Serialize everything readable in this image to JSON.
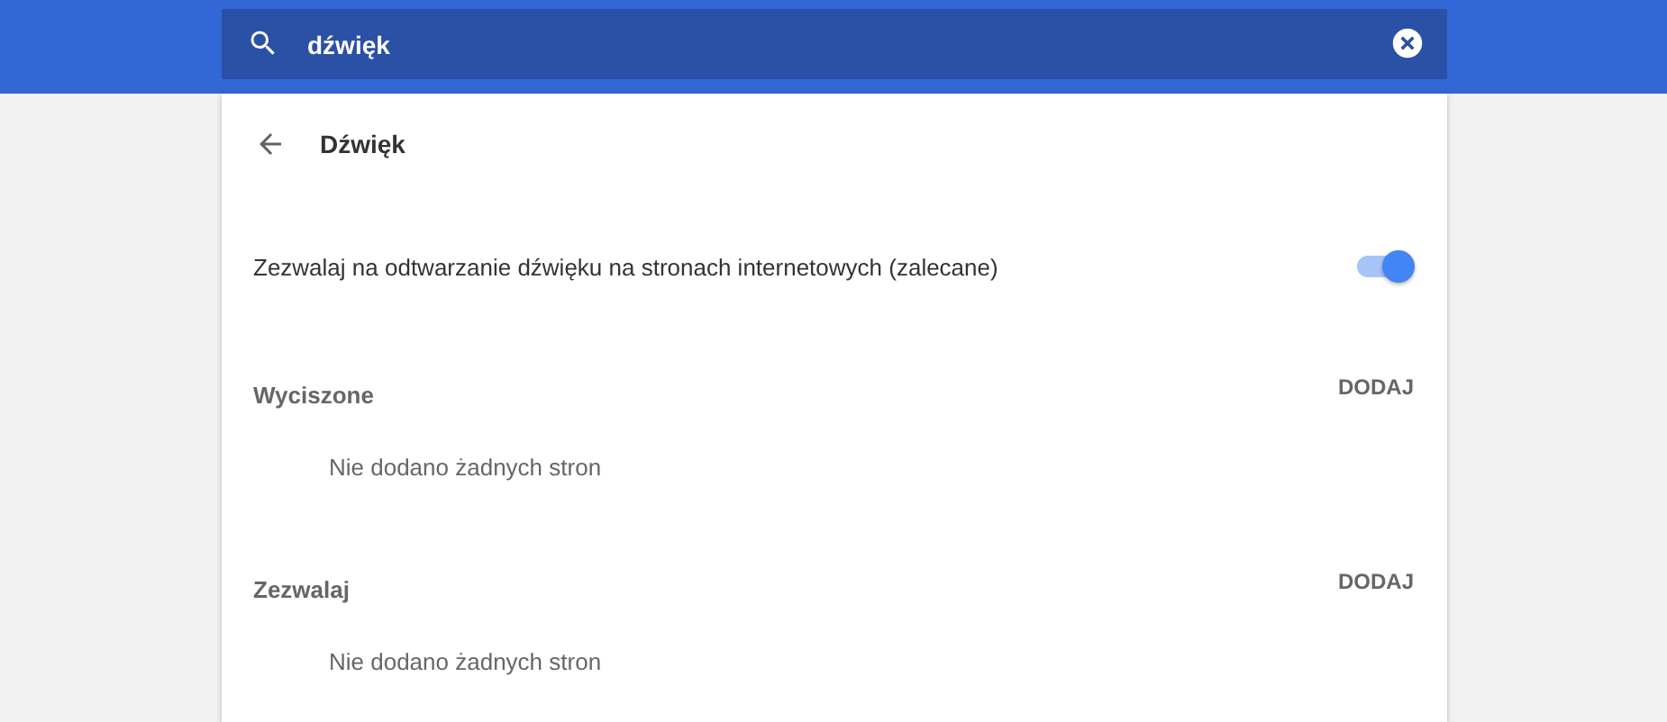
{
  "search": {
    "value": "dźwięk"
  },
  "page": {
    "title": "Dźwięk"
  },
  "setting": {
    "label": "Zezwalaj na odtwarzanie dźwięku na stronach internetowych (zalecane)",
    "on": true
  },
  "sections": [
    {
      "title": "Wyciszone",
      "action": "DODAJ",
      "empty": "Nie dodano żadnych stron"
    },
    {
      "title": "Zezwalaj",
      "action": "DODAJ",
      "empty": "Nie dodano żadnych stron"
    }
  ]
}
